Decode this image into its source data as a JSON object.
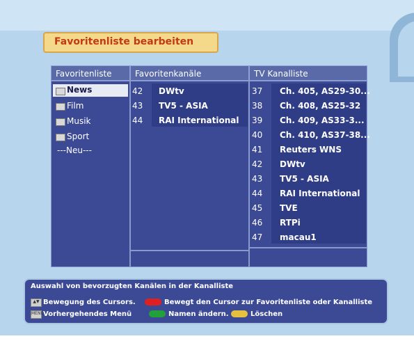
{
  "title": "Favoritenliste bearbeiten",
  "columns": {
    "favorites_list": "Favoritenliste",
    "favorite_channels": "Favoritenkanäle",
    "tv_channel_list": "TV Kanalliste"
  },
  "favorite_groups": [
    {
      "label": "News",
      "selected": true
    },
    {
      "label": "Film"
    },
    {
      "label": "Musik"
    },
    {
      "label": "Sport"
    },
    {
      "label": "---Neu---"
    }
  ],
  "favorite_channels": [
    {
      "num": "42",
      "name": "DWtv"
    },
    {
      "num": "43",
      "name": "TV5 - ASIA"
    },
    {
      "num": "44",
      "name": "RAI International"
    }
  ],
  "tv_channels": [
    {
      "num": "37",
      "name": "Ch. 405, AS29-30..."
    },
    {
      "num": "38",
      "name": "Ch. 408, AS25-32"
    },
    {
      "num": "39",
      "name": "Ch. 409,  AS33-3..."
    },
    {
      "num": "40",
      "name": "Ch. 410, AS37-38..."
    },
    {
      "num": "41",
      "name": "Reuters WNS"
    },
    {
      "num": "42",
      "name": "DWtv"
    },
    {
      "num": "43",
      "name": "TV5 - ASIA"
    },
    {
      "num": "44",
      "name": "RAI International"
    },
    {
      "num": "45",
      "name": "TVE"
    },
    {
      "num": "46",
      "name": "RTPi"
    },
    {
      "num": "47",
      "name": "macau1"
    }
  ],
  "help": {
    "description": "Auswahl von bevorzugten Kanälen in der Kanalliste",
    "cursor_move": "Bewegung des Cursors.",
    "red_action": "Bewegt den Cursor zur Favoritenliste oder Kanalliste",
    "menu_key": "MENU",
    "menu_action": "Vorhergehendes Menü",
    "green_action": "Namen ändern.",
    "yellow_action": "Löschen"
  },
  "colors": {
    "background": "#b7d6ee",
    "panel": "#3c4a96",
    "title_bg": "#f5d98a",
    "title_text": "#c23a14",
    "red_key": "#e02020",
    "green_key": "#22a03a",
    "yellow_key": "#e8c040"
  }
}
